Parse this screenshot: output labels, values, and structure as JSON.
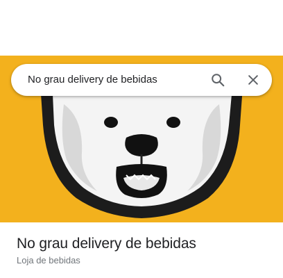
{
  "search": {
    "query": "No grau delivery de bebidas",
    "search_icon": "search-icon",
    "close_icon": "close-icon"
  },
  "hero": {
    "image": "polar-bear-logo",
    "background_color": "#f3b11d"
  },
  "place": {
    "name": "No grau delivery de bebidas",
    "category": "Loja de bebidas"
  }
}
